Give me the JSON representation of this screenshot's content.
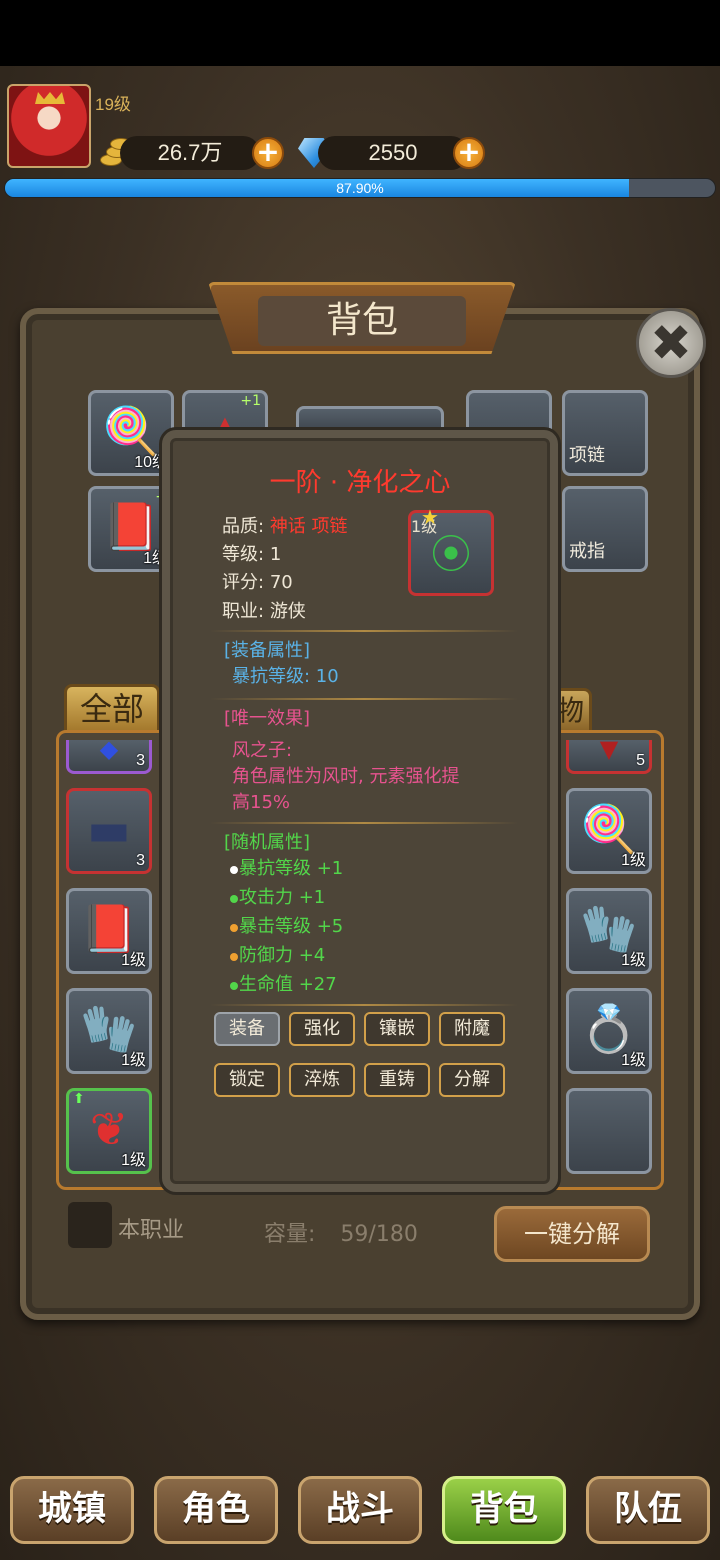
{
  "header": {
    "level": "19级",
    "gold": "26.7万",
    "gems": "2550",
    "exp_percent": 87.9,
    "exp_label": "87.90%"
  },
  "panel": {
    "title": "背包",
    "tab_all": "全部",
    "tab_right_partial": "物",
    "checkbox_label": "本职业",
    "capacity_label": "容量:",
    "capacity_value": "59/180",
    "decompose_all": "一键分解"
  },
  "equip_slots": {
    "staff_level": "10级",
    "hat_plus": "+1",
    "book_level": "1级",
    "book_plus": "+",
    "necklace_label": "项链",
    "ring_label": "戒指"
  },
  "inventory": {
    "left": [
      {
        "icon": "potion-icon",
        "qty": "3",
        "border": "purple"
      },
      {
        "icon": "chest-icon",
        "qty": "3",
        "border": "red"
      },
      {
        "icon": "book-icon",
        "qty": "1级",
        "border": "gray"
      },
      {
        "icon": "glove-icon",
        "qty": "1级",
        "border": "gray"
      },
      {
        "icon": "earring-icon",
        "qty": "1级",
        "border": "green"
      }
    ],
    "right": [
      {
        "icon": "cape-icon",
        "qty": "5",
        "border": "red"
      },
      {
        "icon": "staff-icon",
        "qty": "1级",
        "border": "gray"
      },
      {
        "icon": "glove-icon",
        "qty": "1级",
        "border": "gray"
      },
      {
        "icon": "ring-icon",
        "qty": "1级",
        "border": "gray"
      },
      {
        "icon": "empty",
        "qty": "",
        "border": "gray"
      }
    ]
  },
  "tooltip": {
    "title": "一阶 · 净化之心",
    "quality_label": "品质:",
    "quality_value": "神话 项链",
    "level_label": "等级:",
    "level_value": "1",
    "score_label": "评分:",
    "score_value": "70",
    "class_label": "职业:",
    "class_value": "游侠",
    "item_level": "1级",
    "equip_attr_header": "[装备属性]",
    "equip_attr": "暴抗等级: 10",
    "unique_header": "[唯一效果]",
    "unique_name": "风之子:",
    "unique_desc_1": "角色属性为风时, 元素强化提",
    "unique_desc_2": "高15%",
    "random_header": "[随机属性]",
    "random_attrs": [
      {
        "text": "暴抗等级 +1",
        "dot": "#ffffff"
      },
      {
        "text": "攻击力 +1",
        "dot": "#52d64a"
      },
      {
        "text": "暴击等级 +5",
        "dot": "#f0a030"
      },
      {
        "text": "防御力 +4",
        "dot": "#f0a030"
      },
      {
        "text": "生命值 +27",
        "dot": "#52d64a"
      }
    ],
    "buttons_row1": [
      "装备",
      "强化",
      "镶嵌",
      "附魔"
    ],
    "buttons_row2": [
      "锁定",
      "淬炼",
      "重铸",
      "分解"
    ]
  },
  "nav": [
    "城镇",
    "角色",
    "战斗",
    "背包",
    "队伍"
  ],
  "colors": {
    "accent_red": "#ff3a2e",
    "section_blue": "#5ab2e6",
    "section_pink": "#e7538f",
    "attr_green": "#52d64a",
    "exp_blue": "#1a86e0",
    "nav_active": "#4f8a1c"
  }
}
